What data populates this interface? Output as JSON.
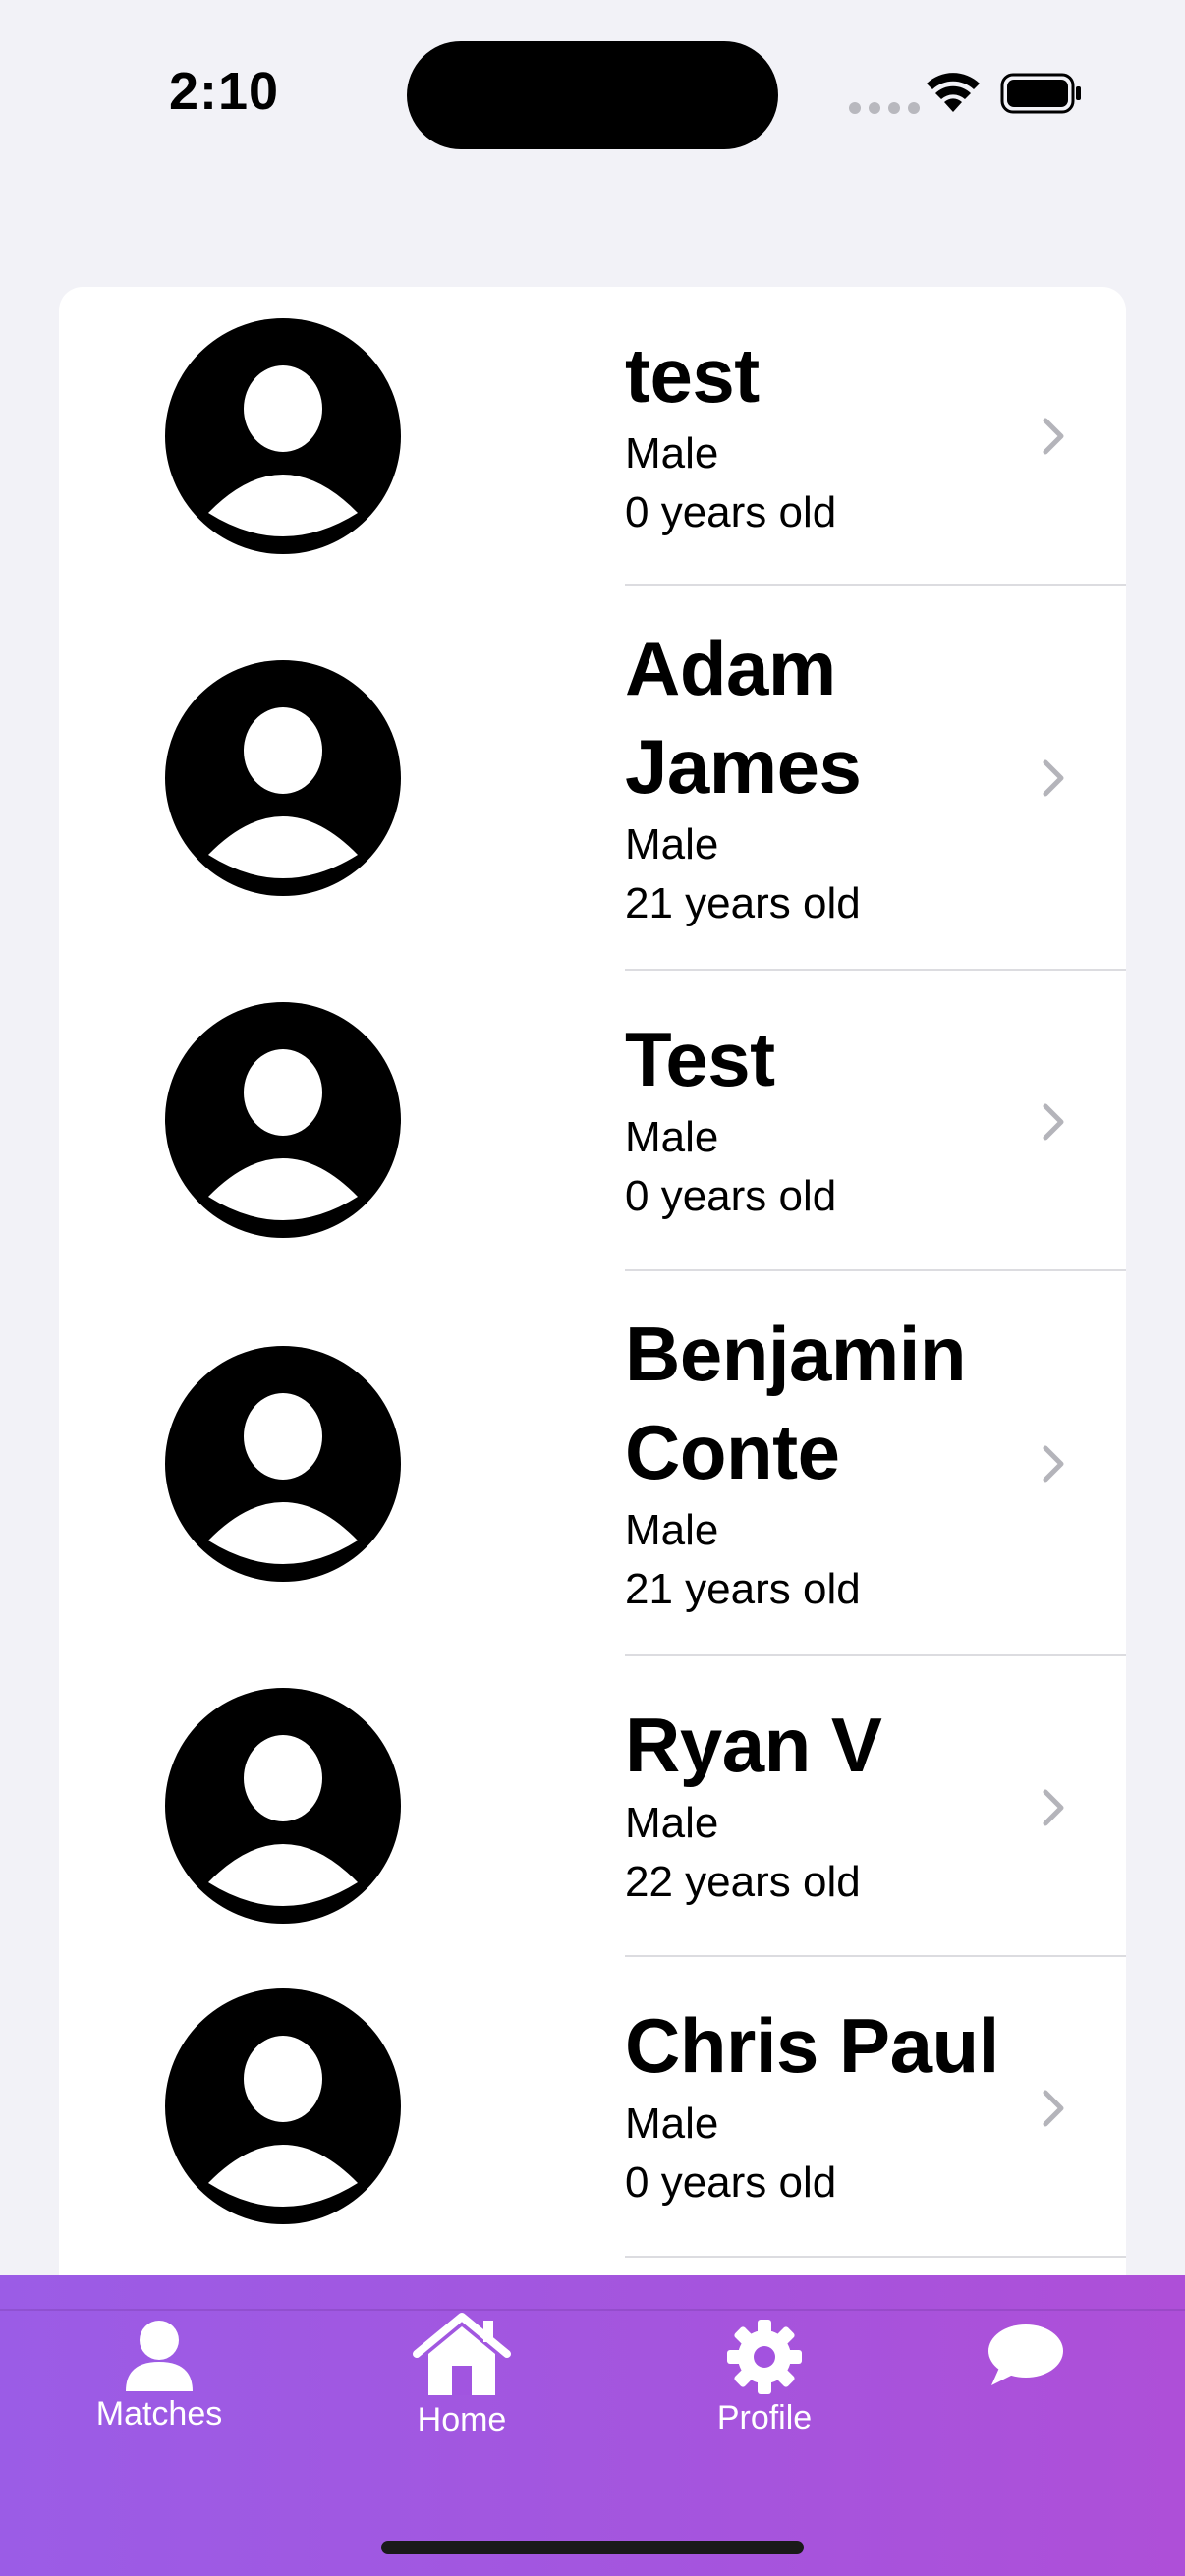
{
  "status_bar": {
    "time": "2:10"
  },
  "matches": [
    {
      "name": "test",
      "gender": "Male",
      "age": "0 years old"
    },
    {
      "name": "Adam James",
      "gender": "Male",
      "age": "21 years old"
    },
    {
      "name": "Test",
      "gender": "Male",
      "age": "0 years old"
    },
    {
      "name": "Benjamin Conte",
      "gender": "Male",
      "age": "21 years old"
    },
    {
      "name": "Ryan V",
      "gender": "Male",
      "age": "22 years old"
    },
    {
      "name": "Chris Paul",
      "gender": "Male",
      "age": "0 years old"
    }
  ],
  "tab_bar": {
    "matches_label": "Matches",
    "home_label": "Home",
    "profile_label": "Profile"
  },
  "colors": {
    "tab_gradient_start": "#9B5CE6",
    "tab_gradient_end": "#AE4FD8",
    "background": "#F2F2F7"
  }
}
